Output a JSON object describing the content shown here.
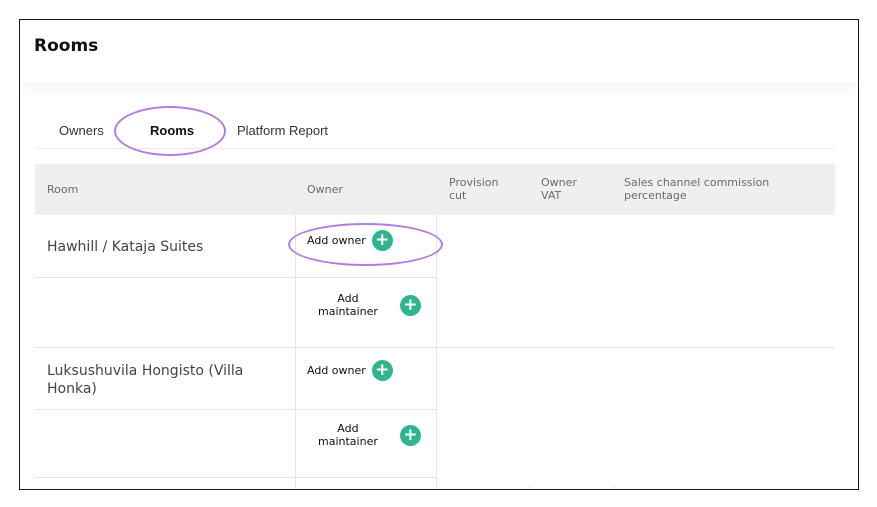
{
  "page": {
    "title": "Rooms"
  },
  "tabs": [
    {
      "label": "Owners"
    },
    {
      "label": "Rooms",
      "active": true
    },
    {
      "label": "Platform Report"
    }
  ],
  "table": {
    "columns": [
      "Room",
      "Owner",
      "Provision\ncut",
      "Owner\nVAT",
      "Sales channel commission\npercentage"
    ],
    "rows": [
      {
        "room": "Hawhill / Kataja Suites",
        "owner_action": "Add owner",
        "maintainer_action": "Add\nmaintainer"
      },
      {
        "room": "Luksushuvila Hongisto (Villa Honka)",
        "owner_action": "Add owner",
        "maintainer_action": "Add\nmaintainer"
      }
    ]
  },
  "colors": {
    "accent_ring": "#b47ee0",
    "add_button": "#2fb58d",
    "header_bg": "#efefef"
  },
  "icons": {
    "add": "plus-circle-icon"
  }
}
